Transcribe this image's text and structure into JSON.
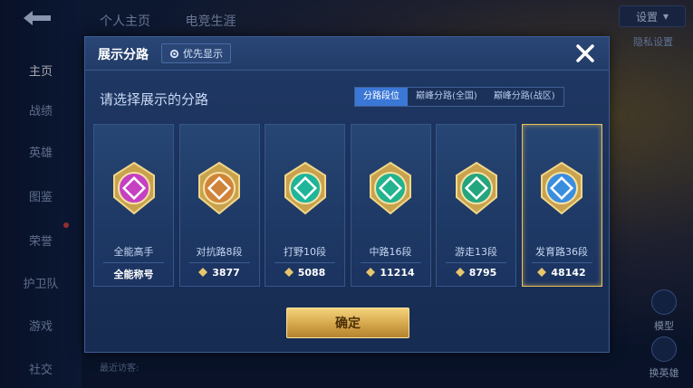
{
  "background": {
    "top_tabs": [
      "个人主页",
      "电竞生涯"
    ],
    "left_nav": [
      {
        "label": "主页",
        "active": true
      },
      {
        "label": "战绩",
        "active": false
      },
      {
        "label": "英雄",
        "active": false
      },
      {
        "label": "图鉴",
        "active": false
      },
      {
        "label": "荣誉",
        "active": false
      },
      {
        "label": "护卫队",
        "active": false
      },
      {
        "label": "游戏",
        "active": false
      },
      {
        "label": "社交",
        "active": false
      }
    ],
    "settings_label": "设置",
    "hint_text": "隐私设置",
    "right_buttons": [
      "模型",
      "换英雄"
    ],
    "recent_label": "最近访客:"
  },
  "modal": {
    "title": "展示分路",
    "priority_label": "优先显示",
    "subtitle": "请选择展示的分路",
    "segment_tabs": [
      {
        "label": "分路段位",
        "active": true
      },
      {
        "label": "巅峰分路(全国)",
        "active": false
      },
      {
        "label": "巅峰分路(战区)",
        "active": false
      }
    ],
    "cards": [
      {
        "name": "全能高手",
        "score": "全能称号",
        "show_diamond": false,
        "color": "#c640c2",
        "selected": false
      },
      {
        "name": "对抗路8段",
        "score": "3877",
        "show_diamond": true,
        "color": "#d0843a",
        "selected": false
      },
      {
        "name": "打野10段",
        "score": "5088",
        "show_diamond": true,
        "color": "#1fb59a",
        "selected": false
      },
      {
        "name": "中路16段",
        "score": "11214",
        "show_diamond": true,
        "color": "#22b38f",
        "selected": false
      },
      {
        "name": "游走13段",
        "score": "8795",
        "show_diamond": true,
        "color": "#23a67e",
        "selected": false
      },
      {
        "name": "发育路36段",
        "score": "48142",
        "show_diamond": true,
        "color": "#3a8ee0",
        "selected": true
      }
    ],
    "confirm_label": "确定"
  },
  "colors": {
    "accent_blue": "#3a77d6",
    "gold": "#e8c15a",
    "panel": "#1f3a66"
  }
}
